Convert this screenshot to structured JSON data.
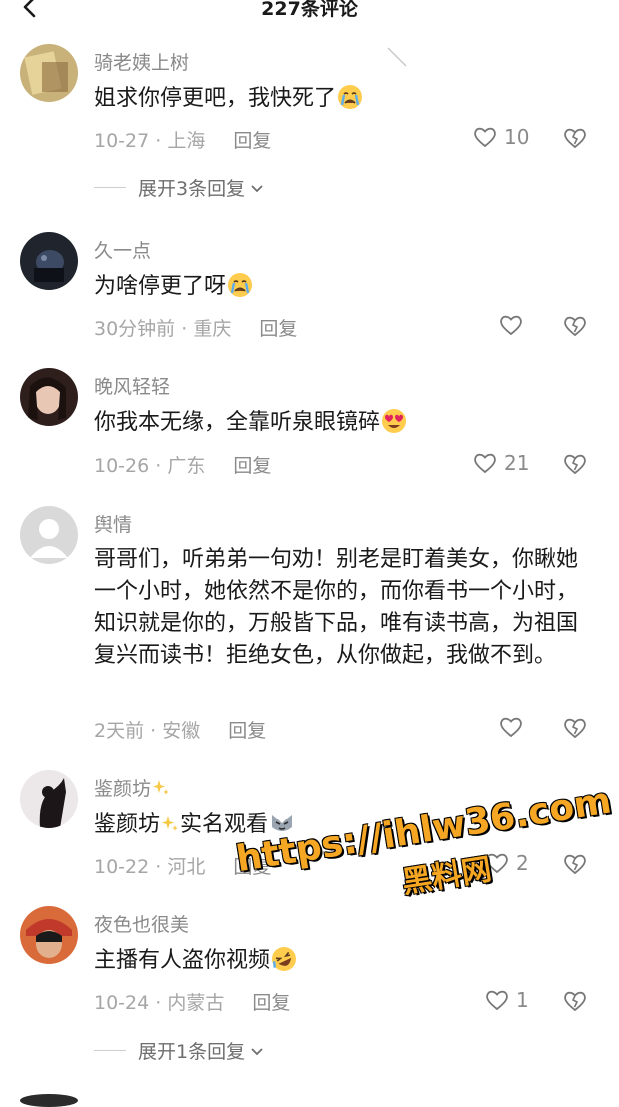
{
  "header": {
    "title": "227条评论"
  },
  "comments": [
    {
      "username": "骑老姨上树",
      "content": "姐求你停更吧，我快死了",
      "date": "10-27",
      "location": "上海",
      "reply": "回复",
      "likes": "10",
      "expand": "展开3条回复",
      "avatar_color": "#c8b27a",
      "emoji": "crying-face"
    },
    {
      "username": "久一点",
      "content": "为啥停更了呀",
      "date": "30分钟前",
      "location": "重庆",
      "reply": "回复",
      "likes": "",
      "avatar_color": "#2a2f3a",
      "emoji": "crying-face"
    },
    {
      "username": "晚风轻轻",
      "content": "你我本无缘，全靠听泉眼镜碎",
      "date": "10-26",
      "location": "广东",
      "reply": "回复",
      "likes": "21",
      "avatar_color": "#3b2a28",
      "emoji": "heart-eyes-face"
    },
    {
      "username": "舆情",
      "content": "哥哥们，听弟弟一句劝！别老是盯着美女，你瞅她一个小时，她依然不是你的，而你看书一个小时，知识就是你的，万般皆下品，唯有读书高，为祖国复兴而读书！拒绝女色，从你做起，我做不到。",
      "date": "2天前",
      "location": "安徽",
      "reply": "回复",
      "likes": "",
      "avatar_color": "#d9d9d9",
      "emoji": ""
    },
    {
      "username": "鉴颜坊",
      "content_prefix": "鉴颜坊",
      "content_suffix": "实名观看",
      "date": "10-22",
      "location": "河北",
      "reply": "回复",
      "likes": "2",
      "avatar_color": "#e8e4e6",
      "emoji": "cat-face"
    },
    {
      "username": "夜色也很美",
      "content": "主播有人盗你视频",
      "date": "10-24",
      "location": "内蒙古",
      "reply": "回复",
      "likes": "1",
      "expand": "展开1条回复",
      "avatar_color": "#b85a3a",
      "emoji": "rolling-laugh-face"
    }
  ],
  "separator": "·",
  "watermark": {
    "url": "https://ihlw36.com",
    "name": "黑料网"
  },
  "colors": {
    "text": "#1a1a1a",
    "muted": "#8a8a8a",
    "watermark": "#f5a623"
  }
}
